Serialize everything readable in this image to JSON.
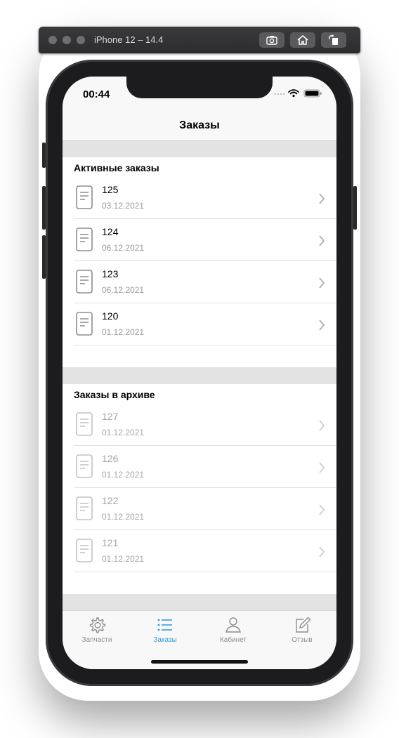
{
  "simulator": {
    "title": "iPhone 12 – 14.4"
  },
  "status_bar": {
    "time": "00:44"
  },
  "nav": {
    "title": "Заказы"
  },
  "active_section": {
    "title": "Активные заказы",
    "orders": [
      {
        "number": "125",
        "date": "03.12.2021"
      },
      {
        "number": "124",
        "date": "06.12.2021"
      },
      {
        "number": "123",
        "date": "06.12.2021"
      },
      {
        "number": "120",
        "date": "01.12.2021"
      }
    ]
  },
  "archive_section": {
    "title": "Заказы в архиве",
    "orders": [
      {
        "number": "127",
        "date": "01.12.2021"
      },
      {
        "number": "126",
        "date": "01.12.2021"
      },
      {
        "number": "122",
        "date": "01.12.2021"
      },
      {
        "number": "121",
        "date": "01.12.2021"
      }
    ]
  },
  "tabbar": {
    "tabs": [
      {
        "label": "Запчасти",
        "icon": "gear-icon"
      },
      {
        "label": "Заказы",
        "icon": "list-icon"
      },
      {
        "label": "Кабинет",
        "icon": "person-icon"
      },
      {
        "label": "Отзыв",
        "icon": "compose-icon"
      }
    ],
    "active_color": "#2f9ee0",
    "inactive_color": "#8e8e8e"
  }
}
